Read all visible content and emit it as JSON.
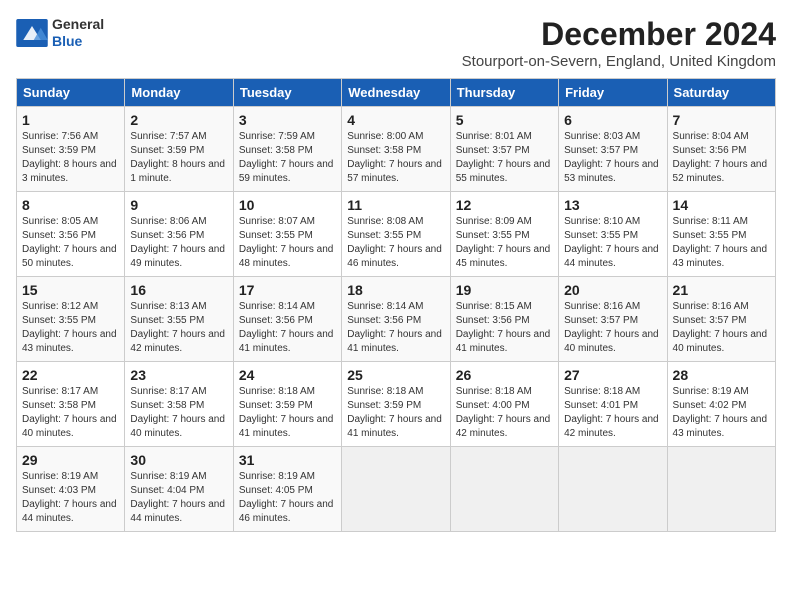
{
  "header": {
    "logo_line1": "General",
    "logo_line2": "Blue",
    "month_title": "December 2024",
    "location": "Stourport-on-Severn, England, United Kingdom"
  },
  "days_of_week": [
    "Sunday",
    "Monday",
    "Tuesday",
    "Wednesday",
    "Thursday",
    "Friday",
    "Saturday"
  ],
  "weeks": [
    [
      {
        "day": "1",
        "info": "Sunrise: 7:56 AM\nSunset: 3:59 PM\nDaylight: 8 hours and 3 minutes."
      },
      {
        "day": "2",
        "info": "Sunrise: 7:57 AM\nSunset: 3:59 PM\nDaylight: 8 hours and 1 minute."
      },
      {
        "day": "3",
        "info": "Sunrise: 7:59 AM\nSunset: 3:58 PM\nDaylight: 7 hours and 59 minutes."
      },
      {
        "day": "4",
        "info": "Sunrise: 8:00 AM\nSunset: 3:58 PM\nDaylight: 7 hours and 57 minutes."
      },
      {
        "day": "5",
        "info": "Sunrise: 8:01 AM\nSunset: 3:57 PM\nDaylight: 7 hours and 55 minutes."
      },
      {
        "day": "6",
        "info": "Sunrise: 8:03 AM\nSunset: 3:57 PM\nDaylight: 7 hours and 53 minutes."
      },
      {
        "day": "7",
        "info": "Sunrise: 8:04 AM\nSunset: 3:56 PM\nDaylight: 7 hours and 52 minutes."
      }
    ],
    [
      {
        "day": "8",
        "info": "Sunrise: 8:05 AM\nSunset: 3:56 PM\nDaylight: 7 hours and 50 minutes."
      },
      {
        "day": "9",
        "info": "Sunrise: 8:06 AM\nSunset: 3:56 PM\nDaylight: 7 hours and 49 minutes."
      },
      {
        "day": "10",
        "info": "Sunrise: 8:07 AM\nSunset: 3:55 PM\nDaylight: 7 hours and 48 minutes."
      },
      {
        "day": "11",
        "info": "Sunrise: 8:08 AM\nSunset: 3:55 PM\nDaylight: 7 hours and 46 minutes."
      },
      {
        "day": "12",
        "info": "Sunrise: 8:09 AM\nSunset: 3:55 PM\nDaylight: 7 hours and 45 minutes."
      },
      {
        "day": "13",
        "info": "Sunrise: 8:10 AM\nSunset: 3:55 PM\nDaylight: 7 hours and 44 minutes."
      },
      {
        "day": "14",
        "info": "Sunrise: 8:11 AM\nSunset: 3:55 PM\nDaylight: 7 hours and 43 minutes."
      }
    ],
    [
      {
        "day": "15",
        "info": "Sunrise: 8:12 AM\nSunset: 3:55 PM\nDaylight: 7 hours and 43 minutes."
      },
      {
        "day": "16",
        "info": "Sunrise: 8:13 AM\nSunset: 3:55 PM\nDaylight: 7 hours and 42 minutes."
      },
      {
        "day": "17",
        "info": "Sunrise: 8:14 AM\nSunset: 3:56 PM\nDaylight: 7 hours and 41 minutes."
      },
      {
        "day": "18",
        "info": "Sunrise: 8:14 AM\nSunset: 3:56 PM\nDaylight: 7 hours and 41 minutes."
      },
      {
        "day": "19",
        "info": "Sunrise: 8:15 AM\nSunset: 3:56 PM\nDaylight: 7 hours and 41 minutes."
      },
      {
        "day": "20",
        "info": "Sunrise: 8:16 AM\nSunset: 3:57 PM\nDaylight: 7 hours and 40 minutes."
      },
      {
        "day": "21",
        "info": "Sunrise: 8:16 AM\nSunset: 3:57 PM\nDaylight: 7 hours and 40 minutes."
      }
    ],
    [
      {
        "day": "22",
        "info": "Sunrise: 8:17 AM\nSunset: 3:58 PM\nDaylight: 7 hours and 40 minutes."
      },
      {
        "day": "23",
        "info": "Sunrise: 8:17 AM\nSunset: 3:58 PM\nDaylight: 7 hours and 40 minutes."
      },
      {
        "day": "24",
        "info": "Sunrise: 8:18 AM\nSunset: 3:59 PM\nDaylight: 7 hours and 41 minutes."
      },
      {
        "day": "25",
        "info": "Sunrise: 8:18 AM\nSunset: 3:59 PM\nDaylight: 7 hours and 41 minutes."
      },
      {
        "day": "26",
        "info": "Sunrise: 8:18 AM\nSunset: 4:00 PM\nDaylight: 7 hours and 42 minutes."
      },
      {
        "day": "27",
        "info": "Sunrise: 8:18 AM\nSunset: 4:01 PM\nDaylight: 7 hours and 42 minutes."
      },
      {
        "day": "28",
        "info": "Sunrise: 8:19 AM\nSunset: 4:02 PM\nDaylight: 7 hours and 43 minutes."
      }
    ],
    [
      {
        "day": "29",
        "info": "Sunrise: 8:19 AM\nSunset: 4:03 PM\nDaylight: 7 hours and 44 minutes."
      },
      {
        "day": "30",
        "info": "Sunrise: 8:19 AM\nSunset: 4:04 PM\nDaylight: 7 hours and 44 minutes."
      },
      {
        "day": "31",
        "info": "Sunrise: 8:19 AM\nSunset: 4:05 PM\nDaylight: 7 hours and 46 minutes."
      },
      null,
      null,
      null,
      null
    ]
  ]
}
